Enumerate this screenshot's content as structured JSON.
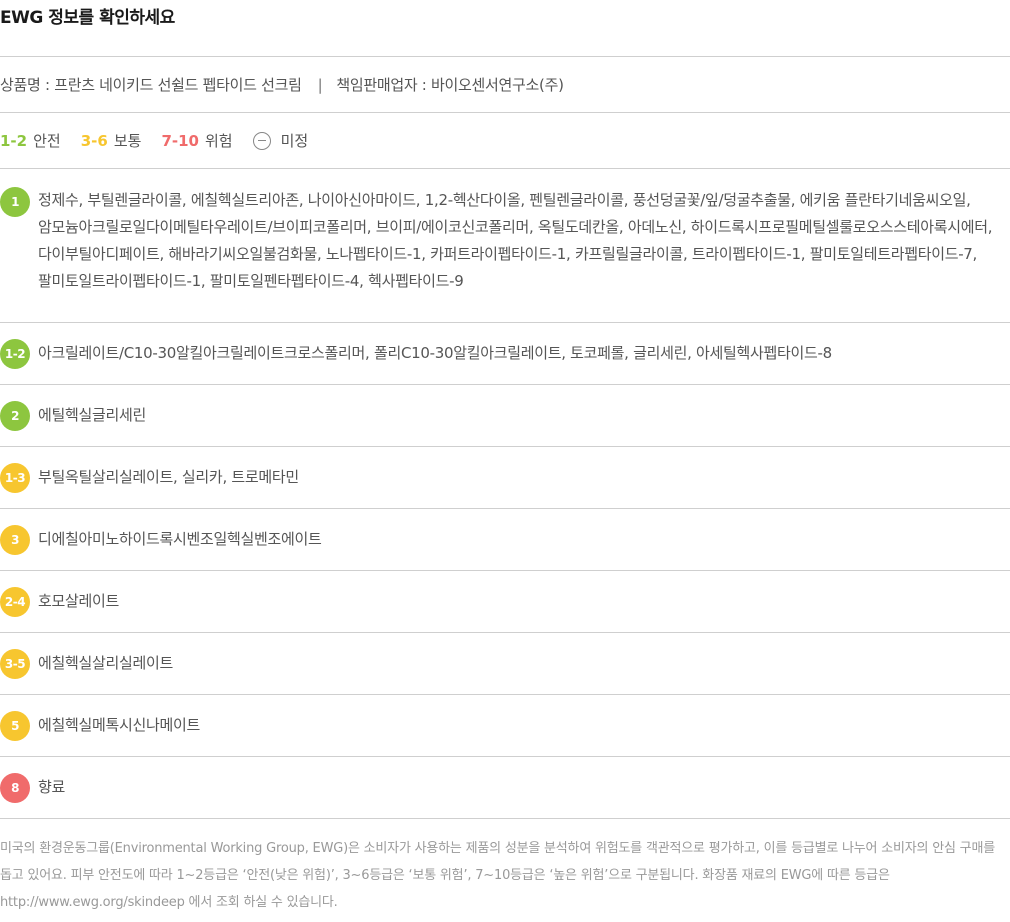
{
  "title": "EWG 정보를 확인하세요",
  "product": {
    "name_text": "상품명 : 프란츠 네이키드 선쉴드 펩타이드 선크림",
    "separator": "|",
    "seller_text": "책임판매업자 : 바이오센서연구소(주)"
  },
  "legend": {
    "items": [
      {
        "range": "1-2",
        "label": "안전",
        "color": "#8dc63f"
      },
      {
        "range": "3-6",
        "label": "보통",
        "color": "#f7c62f"
      },
      {
        "range": "7-10",
        "label": "위험",
        "color": "#f06b6b"
      }
    ],
    "undetermined_label": "미정"
  },
  "rows": [
    {
      "grade": "1",
      "color": "green",
      "text": "정제수, 부틸렌글라이콜, 에칠헥실트리아존, 나이아신아마이드, 1,2-헥산다이올, 펜틸렌글라이콜, 풍선덩굴꽃/잎/덩굴추출물, 에키움 플란타기네움씨오일, 암모늄아크릴로일다이메틸타우레이트/브이피코폴리머, 브이피/에이코신코폴리머, 옥틸도데칸올, 아데노신, 하이드록시프로필메틸셀룰로오스스테아록시에터, 다이부틸아디페이트, 해바라기씨오일불검화물, 노나펩타이드-1, 카퍼트라이펩타이드-1, 카프릴릴글라이콜, 트라이펩타이드-1, 팔미토일테트라펩타이드-7, 팔미토일트라이펩타이드-1, 팔미토일펜타펩타이드-4, 헥사펩타이드-9"
    },
    {
      "grade": "1-2",
      "color": "green",
      "text": "아크릴레이트/C10-30알킬아크릴레이트크로스폴리머, 폴리C10-30알킬아크릴레이트, 토코페롤, 글리세린, 아세틸헥사펩타이드-8"
    },
    {
      "grade": "2",
      "color": "green",
      "text": "에틸헥실글리세린"
    },
    {
      "grade": "1-3",
      "color": "yellow",
      "text": "부틸옥틸살리실레이트, 실리카, 트로메타민"
    },
    {
      "grade": "3",
      "color": "yellow",
      "text": "디에칠아미노하이드록시벤조일헥실벤조에이트"
    },
    {
      "grade": "2-4",
      "color": "yellow",
      "text": "호모살레이트"
    },
    {
      "grade": "3-5",
      "color": "yellow",
      "text": "에칠헥실살리실레이트"
    },
    {
      "grade": "5",
      "color": "yellow",
      "text": "에칠헥실메톡시신나메이트"
    },
    {
      "grade": "8",
      "color": "red",
      "text": "향료"
    }
  ],
  "footnote": "미국의 환경운동그룹(Environmental Working Group, EWG)은 소비자가 사용하는 제품의 성분을 분석하여 위험도를 객관적으로 평가하고, 이를 등급별로 나누어 소비자의 안심 구매를 돕고 있어요. 피부 안전도에 따라 1~2등급은 ‘안전(낮은 위험)’, 3~6등급은 ‘보통 위험’, 7~10등급은 ‘높은 위험’으로 구분됩니다. 화장품 재료의 EWG에 따른 등급은 http://www.ewg.org/skindeep 에서 조회 하실 수 있습니다."
}
